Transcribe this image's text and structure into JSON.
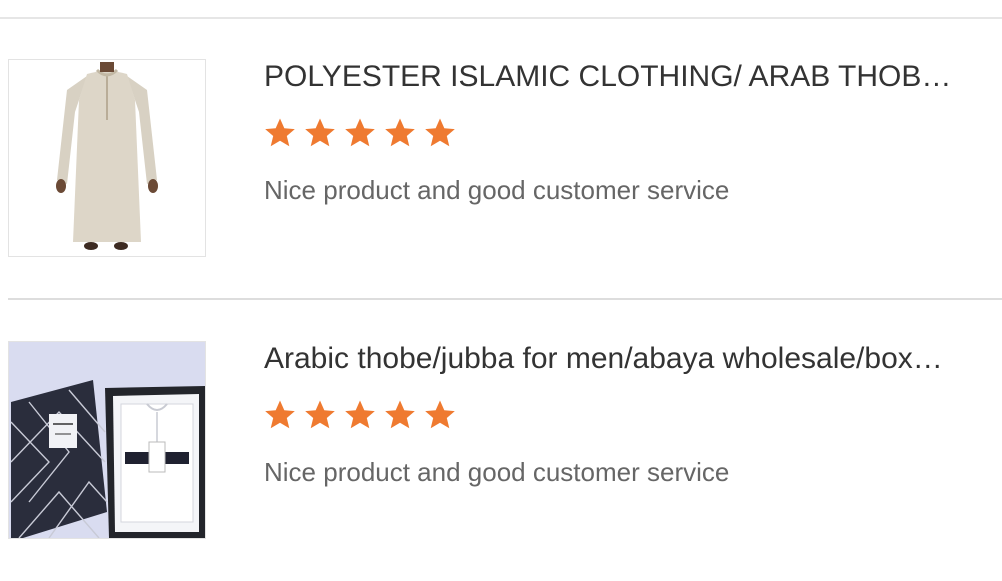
{
  "colors": {
    "star": "#ef7a30",
    "title": "#333333",
    "comment": "#666666",
    "divider": "#dddddd"
  },
  "reviews": [
    {
      "title": "POLYESTER ISLAMIC CLOTHING/ ARAB THOBE FOR MEN",
      "rating": 5,
      "comment": "Nice product and good customer service",
      "image_icon": "beige-thobe-image"
    },
    {
      "title": "Arabic thobe/jubba for men/abaya wholesale/boxed thobe",
      "rating": 5,
      "comment": "Nice product and good customer service",
      "image_icon": "boxed-white-thobe-image"
    }
  ]
}
